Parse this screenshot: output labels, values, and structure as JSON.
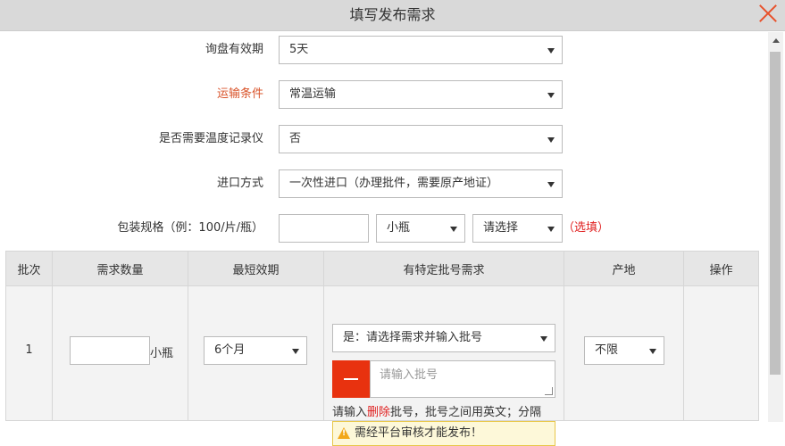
{
  "dialog": {
    "title": "填写发布需求"
  },
  "form": {
    "validity_label": "询盘有效期",
    "validity_value": "5天",
    "transport_label": "运输条件",
    "transport_value": "常温运输",
    "temp_recorder_label": "是否需要温度记录仪",
    "temp_recorder_value": "否",
    "import_label": "进口方式",
    "import_value": "一次性进口（办理批件，需要原产地证）",
    "package_label": "包装规格（例：100/片/瓶）",
    "package_value": "",
    "package_unit": "小瓶",
    "package_select": "请选择",
    "optional_note": "（选填）"
  },
  "table": {
    "headers": [
      "批次",
      "需求数量",
      "最短效期",
      "有特定批号需求",
      "产地",
      "操作"
    ],
    "rows": [
      {
        "batch": "1",
        "quantity_value": "",
        "quantity_unit": "小瓶",
        "min_validity": "6个月",
        "batch_requirement": "是：请选择需求并输入批号",
        "batch_placeholder": "请输入批号",
        "hint_prefix": "请输入",
        "hint_delete": "删除",
        "hint_suffix": "批号，批号之间用英文；分隔",
        "warning": "需经平台审核才能发布！",
        "origin": "不限"
      }
    ]
  },
  "colors": {
    "accent": "#d9542b",
    "danger": "#e8320f",
    "header_bg": "#d9d9d9"
  },
  "icons": [
    "close-icon",
    "warning-icon",
    "minus-icon",
    "chevron-down-icon"
  ]
}
